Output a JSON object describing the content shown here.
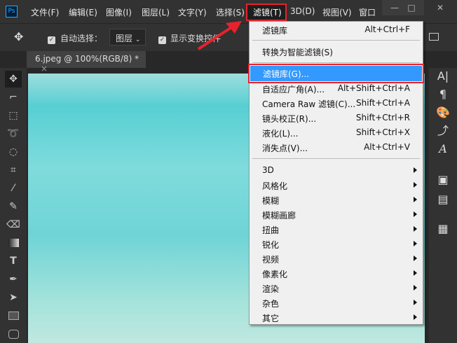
{
  "menubar": {
    "logo": "Ps",
    "items": [
      "文件(F)",
      "编辑(E)",
      "图像(I)",
      "图层(L)",
      "文字(Y)",
      "选择(S)",
      "滤镜(T)",
      "3D(D)",
      "视图(V)",
      "窗口"
    ],
    "window_buttons": [
      "—",
      "□",
      "✕"
    ]
  },
  "options": {
    "auto_select_label": "自动选择：",
    "layer_select": "图层",
    "show_transform_label": "显示变换控件"
  },
  "document_tab": {
    "title": "6.jpeg @ 100%(RGB/8) *",
    "close": "×"
  },
  "filter_menu": {
    "top": [
      {
        "label": "滤镜库",
        "shortcut": "Alt+Ctrl+F"
      }
    ],
    "convert": {
      "label": "转换为智能滤镜(S)"
    },
    "highlighted": {
      "label": "滤镜库(G)..."
    },
    "middle": [
      {
        "label": "自适应广角(A)...",
        "shortcut": "Alt+Shift+Ctrl+A"
      },
      {
        "label": "Camera Raw 滤镜(C)...",
        "shortcut": "Shift+Ctrl+A"
      },
      {
        "label": "镜头校正(R)...",
        "shortcut": "Shift+Ctrl+R"
      },
      {
        "label": "液化(L)...",
        "shortcut": "Shift+Ctrl+X"
      },
      {
        "label": "消失点(V)...",
        "shortcut": "Alt+Ctrl+V"
      }
    ],
    "submenus": [
      "3D",
      "风格化",
      "模糊",
      "模糊画廊",
      "扭曲",
      "锐化",
      "视频",
      "像素化",
      "渲染",
      "杂色",
      "其它"
    ]
  },
  "colors": {
    "highlight": "#3399ff",
    "annotation": "#e8222c"
  }
}
